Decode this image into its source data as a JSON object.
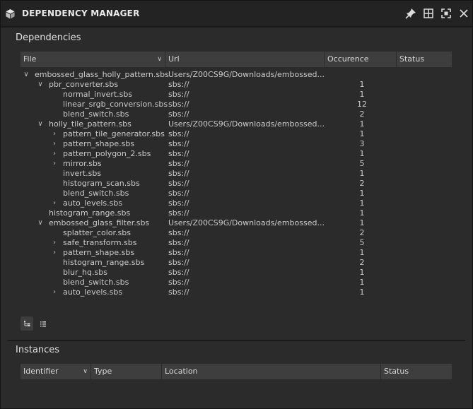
{
  "window": {
    "title": "DEPENDENCY MANAGER",
    "icons": [
      "cube-logo-icon",
      "pin-icon",
      "layout-icon",
      "maximize-icon",
      "close-icon"
    ]
  },
  "dependencies": {
    "label": "Dependencies",
    "columns": {
      "file": "File",
      "url": "Url",
      "occurence": "Occurence",
      "status": "Status"
    },
    "rows": [
      {
        "name": "embossed_glass_holly_pattern.sbs",
        "url": "Users/Z00CS9G/Downloads/embossed...",
        "occ": "",
        "depth": 0,
        "arrow": "down"
      },
      {
        "name": "pbr_converter.sbs",
        "url": "sbs://",
        "occ": "1",
        "depth": 1,
        "arrow": "down"
      },
      {
        "name": "normal_invert.sbs",
        "url": "sbs://",
        "occ": "1",
        "depth": 2,
        "arrow": ""
      },
      {
        "name": "linear_srgb_conversion.sbs",
        "url": "sbs://",
        "occ": "12",
        "depth": 2,
        "arrow": ""
      },
      {
        "name": "blend_switch.sbs",
        "url": "sbs://",
        "occ": "2",
        "depth": 2,
        "arrow": ""
      },
      {
        "name": "holly_tile_pattern.sbs",
        "url": "Users/Z00CS9G/Downloads/embossed...",
        "occ": "1",
        "depth": 1,
        "arrow": "down"
      },
      {
        "name": "pattern_tile_generator.sbs",
        "url": "sbs://",
        "occ": "1",
        "depth": 2,
        "arrow": "right"
      },
      {
        "name": "pattern_shape.sbs",
        "url": "sbs://",
        "occ": "3",
        "depth": 2,
        "arrow": "right"
      },
      {
        "name": "pattern_polygon_2.sbs",
        "url": "sbs://",
        "occ": "1",
        "depth": 2,
        "arrow": "right"
      },
      {
        "name": "mirror.sbs",
        "url": "sbs://",
        "occ": "5",
        "depth": 2,
        "arrow": "right"
      },
      {
        "name": "invert.sbs",
        "url": "sbs://",
        "occ": "1",
        "depth": 2,
        "arrow": ""
      },
      {
        "name": "histogram_scan.sbs",
        "url": "sbs://",
        "occ": "2",
        "depth": 2,
        "arrow": ""
      },
      {
        "name": "blend_switch.sbs",
        "url": "sbs://",
        "occ": "1",
        "depth": 2,
        "arrow": ""
      },
      {
        "name": "auto_levels.sbs",
        "url": "sbs://",
        "occ": "1",
        "depth": 2,
        "arrow": "right"
      },
      {
        "name": "histogram_range.sbs",
        "url": "sbs://",
        "occ": "1",
        "depth": 1,
        "arrow": ""
      },
      {
        "name": "embossed_glass_filter.sbs",
        "url": "Users/Z00CS9G/Downloads/embossed...",
        "occ": "1",
        "depth": 1,
        "arrow": "down"
      },
      {
        "name": "splatter_color.sbs",
        "url": "sbs://",
        "occ": "2",
        "depth": 2,
        "arrow": ""
      },
      {
        "name": "safe_transform.sbs",
        "url": "sbs://",
        "occ": "5",
        "depth": 2,
        "arrow": "right"
      },
      {
        "name": "pattern_shape.sbs",
        "url": "sbs://",
        "occ": "1",
        "depth": 2,
        "arrow": "right"
      },
      {
        "name": "histogram_range.sbs",
        "url": "sbs://",
        "occ": "2",
        "depth": 2,
        "arrow": ""
      },
      {
        "name": "blur_hq.sbs",
        "url": "sbs://",
        "occ": "1",
        "depth": 2,
        "arrow": ""
      },
      {
        "name": "blend_switch.sbs",
        "url": "sbs://",
        "occ": "1",
        "depth": 2,
        "arrow": ""
      },
      {
        "name": "auto_levels.sbs",
        "url": "sbs://",
        "occ": "1",
        "depth": 2,
        "arrow": "right"
      }
    ]
  },
  "view_buttons": [
    {
      "icon": "tree-view-icon",
      "active": true
    },
    {
      "icon": "list-view-icon",
      "active": false
    }
  ],
  "instances": {
    "label": "Instances",
    "columns": {
      "identifier": "Identifier",
      "type": "Type",
      "location": "Location",
      "status": "Status"
    }
  }
}
